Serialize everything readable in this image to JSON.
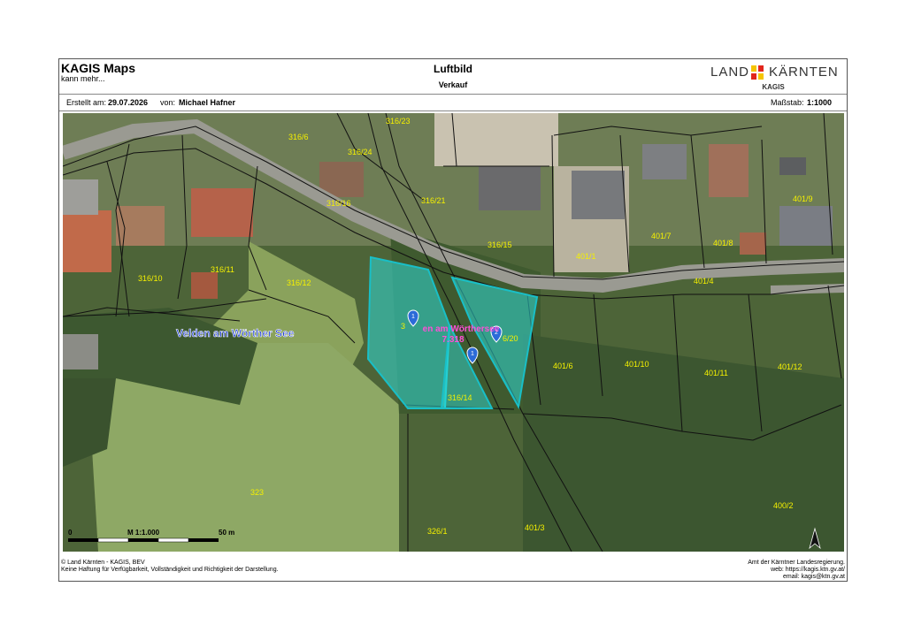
{
  "header": {
    "brand": "KAGIS Maps",
    "brand_sub": "kann mehr...",
    "title": "Luftbild",
    "subtitle": "Verkauf",
    "logo_left": "LAND",
    "logo_right": "KÄRNTEN",
    "logo_sub": "KAGIS"
  },
  "meta": {
    "created_label": "Erstellt am:",
    "created_date": "29.07.2026",
    "author_label": "von:",
    "author": "Michael Hafner",
    "scale_label": "Maßstab:",
    "scale": "1:1000"
  },
  "map": {
    "place_label": "Velden am Wörther See",
    "highlight_label_1": "en am  Wörthersee",
    "highlight_label_2": "7.318",
    "parcel_labels": [
      "316/23",
      "316/6",
      "316/24",
      "316/16",
      "316/21",
      "316/15",
      "401/1",
      "401/7",
      "401/8",
      "401/9",
      "316/10",
      "316/11",
      "316/12",
      "401/4",
      "3",
      "6/20",
      "401/6",
      "401/10",
      "401/11",
      "401/12",
      "316/14",
      "323",
      "326/1",
      "401/3",
      "400/2"
    ],
    "scalebar": {
      "start": "0",
      "scale_text": "M 1:1.000",
      "end": "50 m"
    },
    "markers": [
      "1",
      "2",
      "1"
    ],
    "north_arrow": "north-arrow",
    "colors": {
      "highlight_fill": "#2ee6e6",
      "highlight_stroke": "#19bfc7",
      "parcel_label": "#f5f000",
      "place_label": "#1a3bd6",
      "road": "#9a9a92"
    }
  },
  "footer": {
    "left_line1": "© Land Kärnten - KAGIS, BEV",
    "left_line2": "Keine Haftung für Verfügbarkeit, Vollständigkeit und Richtigkeit der Darstellung.",
    "right_line1": "Amt der Kärntner Landesregierung.",
    "right_line2": "web: https://kagis.ktn.gv.at/",
    "right_line3": "email: kagis@ktn.gv.at"
  }
}
